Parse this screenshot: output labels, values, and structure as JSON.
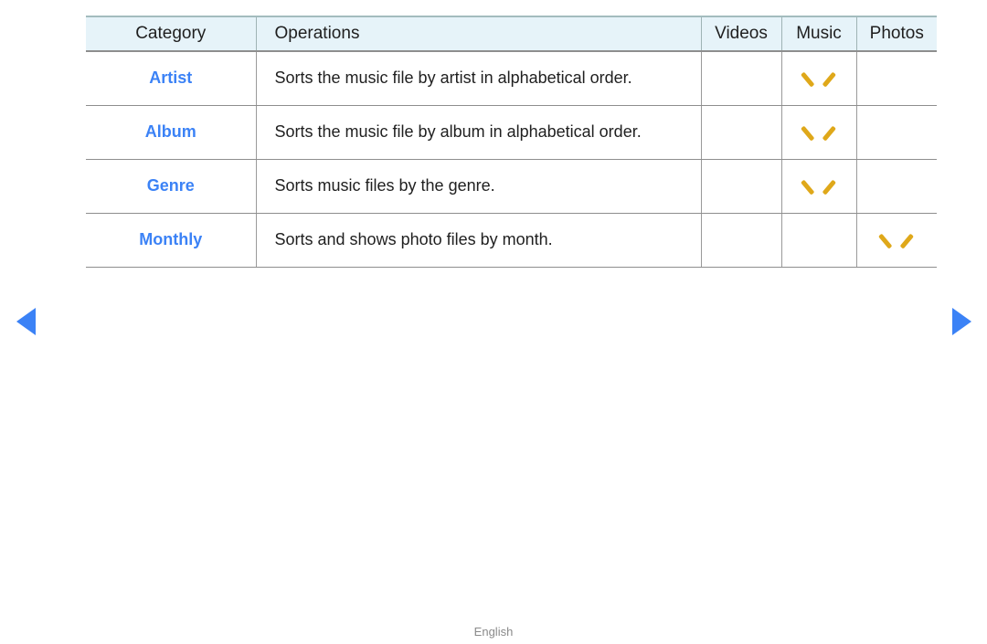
{
  "table": {
    "columns": [
      {
        "key": "category",
        "label": "Category"
      },
      {
        "key": "operations",
        "label": "Operations"
      },
      {
        "key": "videos",
        "label": "Videos"
      },
      {
        "key": "music",
        "label": "Music"
      },
      {
        "key": "photos",
        "label": "Photos"
      }
    ],
    "rows": [
      {
        "category": "Artist",
        "operations": "Sorts the music file by artist in alphabetical order.",
        "videos": "",
        "music": "chevron-down-icon",
        "photos": ""
      },
      {
        "category": "Album",
        "operations": "Sorts the music file by album in alphabetical order.",
        "videos": "",
        "music": "chevron-down-icon",
        "photos": ""
      },
      {
        "category": "Genre",
        "operations": "Sorts music files by the genre.",
        "videos": "",
        "music": "chevron-down-icon",
        "photos": ""
      },
      {
        "category": "Monthly",
        "operations": "Sorts and shows photo files by month.",
        "videos": "",
        "music": "",
        "photos": "chevron-down-icon"
      }
    ]
  },
  "navigation": {
    "prev_icon": "triangle-left-icon",
    "next_icon": "triangle-right-icon"
  },
  "footer": {
    "language": "English"
  },
  "colors": {
    "header_background": "#e6f3f9",
    "header_top_border": "#a3bcbe",
    "category_text": "#3b82f6",
    "chevron": "#dfa81a",
    "nav_arrow": "#3b82f6",
    "footer_text": "#8a8a8a",
    "grid_line": "#8e8e8e"
  }
}
